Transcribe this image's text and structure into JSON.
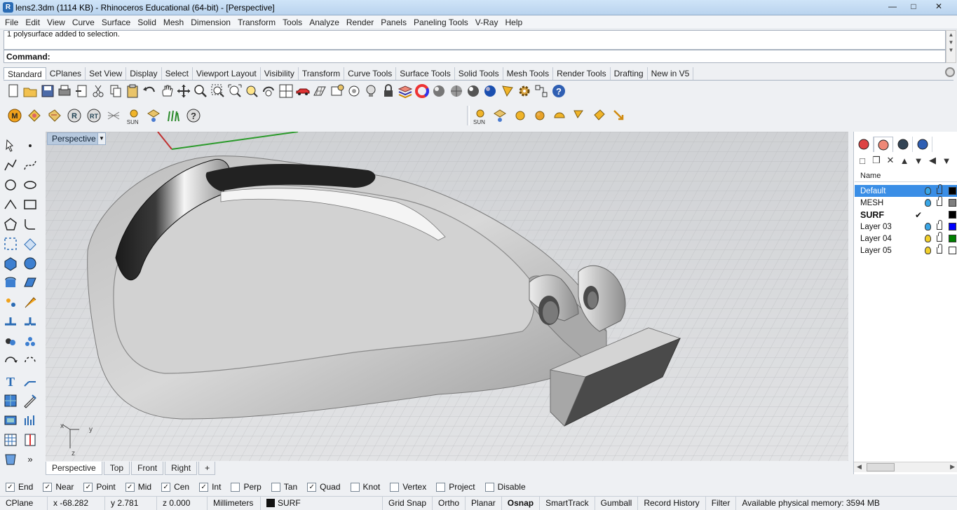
{
  "window": {
    "title": "lens2.3dm (1114 KB) - Rhinoceros Educational (64-bit) - [Perspective]",
    "app_icon": "rhino-logo-icon",
    "controls": [
      "minimize-icon",
      "maximize-icon",
      "close-icon"
    ]
  },
  "menu": [
    "File",
    "Edit",
    "View",
    "Curve",
    "Surface",
    "Solid",
    "Mesh",
    "Dimension",
    "Transform",
    "Tools",
    "Analyze",
    "Render",
    "Panels",
    "Paneling Tools",
    "V-Ray",
    "Help"
  ],
  "command": {
    "history": "1 polysurface added to selection.",
    "prompt": "Command:"
  },
  "toolbar_tabs": {
    "active": "Standard",
    "tabs": [
      "Standard",
      "CPlanes",
      "Set View",
      "Display",
      "Select",
      "Viewport Layout",
      "Visibility",
      "Transform",
      "Curve Tools",
      "Surface Tools",
      "Solid Tools",
      "Mesh Tools",
      "Render Tools",
      "Drafting",
      "New in V5"
    ]
  },
  "standard_toolbar": [
    "new-icon",
    "open-icon",
    "save-icon",
    "print-icon",
    "import-icon",
    "cut-icon",
    "copy-icon",
    "paste-icon",
    "undo-icon",
    "pan-hand-icon",
    "move-view-icon",
    "zoom-icon",
    "zoom-window-icon",
    "zoom-extents-icon",
    "zoom-selected-icon",
    "rotate-view-icon",
    "four-viewports-icon",
    "car-icon",
    "grid-toggle-icon",
    "cplane-icon",
    "lights-icon",
    "lightbulb-icon",
    "lock-icon",
    "layers-icon",
    "color-wheel-icon",
    "render-sphere-icon",
    "shaded-sphere-icon",
    "rendered-sphere-icon",
    "material-sphere-icon",
    "light-cone-icon",
    "options-gear-icon",
    "snap-icon",
    "help-icon"
  ],
  "vray_toolbar": {
    "icons": [
      "vray-m-icon",
      "vray-material-icon",
      "vray-tag-icon",
      "vray-r-icon",
      "vray-rt-icon",
      "vray-grid-icon",
      "vray-sun-icon",
      "vray-light-icon",
      "vray-fur-icon",
      "vray-help-icon"
    ],
    "sun_label": "SUN"
  },
  "lights_toolbar": {
    "icons": [
      "sun-light-icon",
      "plane-light-icon",
      "omni-light-icon",
      "sphere-light-icon",
      "dome-light-icon",
      "spot-light-icon",
      "ies-light-icon",
      "directional-light-icon"
    ],
    "sun_label": "SUN"
  },
  "left_toolbar": [
    "select-arrow-icon",
    "point-icon",
    "polyline-icon",
    "curve-cp-icon",
    "circle-icon",
    "ellipse-icon",
    "arc-icon",
    "rectangle-icon",
    "polygon-icon",
    "fillet-curve-icon",
    "surface-points-icon",
    "surface-edges-icon",
    "box-icon",
    "sphere-icon",
    "cylinder-icon",
    "surface-icon",
    "explode-icon",
    "trim-icon",
    "boolean-union-icon",
    "boolean-split-icon",
    "group-icon",
    "array-icon",
    "rotate-icon",
    "scale-icon",
    "text-icon",
    "dimension-icon",
    "mesh-icon",
    "analyze-icon",
    "block-icon",
    "bar-grid-icon",
    "panel-grid-icon",
    "panel-split-icon",
    "cup-icon",
    "more-icon"
  ],
  "viewport": {
    "title": "Perspective",
    "axis_x": "x",
    "axis_y": "y",
    "axis_z": "z"
  },
  "viewport_tabs": {
    "active": "Perspective",
    "tabs": [
      "Perspective",
      "Top",
      "Front",
      "Right"
    ],
    "add": "+"
  },
  "panel": {
    "tab_icons": [
      "properties-icon",
      "layers-icon",
      "display-icon",
      "help-icon"
    ],
    "tool_icons": [
      "new-layer-icon",
      "new-sublayer-icon",
      "delete-icon",
      "move-up-icon",
      "move-down-icon",
      "move-left-icon",
      "filter-icon"
    ],
    "header": "Name",
    "layers": [
      {
        "name": "Default",
        "selected": true,
        "current": false,
        "bulb": "#3aa6e6",
        "color": "#000000"
      },
      {
        "name": "MESH",
        "selected": false,
        "current": false,
        "bulb": "#3aa6e6",
        "color": "#7f7f7f"
      },
      {
        "name": "SURF",
        "selected": false,
        "current": true,
        "check": "✔",
        "bulb": "",
        "color": "#000000"
      },
      {
        "name": "Layer 03",
        "selected": false,
        "current": false,
        "bulb": "#3aa6e6",
        "color": "#0000ff"
      },
      {
        "name": "Layer 04",
        "selected": false,
        "current": false,
        "bulb": "#f2d02b",
        "color": "#007f00"
      },
      {
        "name": "Layer 05",
        "selected": false,
        "current": false,
        "bulb": "#f2d02b",
        "color": "#ffffff"
      }
    ]
  },
  "osnap": [
    {
      "label": "End",
      "checked": true
    },
    {
      "label": "Near",
      "checked": true
    },
    {
      "label": "Point",
      "checked": true
    },
    {
      "label": "Mid",
      "checked": true
    },
    {
      "label": "Cen",
      "checked": true
    },
    {
      "label": "Int",
      "checked": true
    },
    {
      "label": "Perp",
      "checked": false
    },
    {
      "label": "Tan",
      "checked": false
    },
    {
      "label": "Quad",
      "checked": true
    },
    {
      "label": "Knot",
      "checked": false
    },
    {
      "label": "Vertex",
      "checked": false
    },
    {
      "label": "Project",
      "checked": false
    },
    {
      "label": "Disable",
      "checked": false
    }
  ],
  "status": {
    "cplane": "CPlane",
    "x": "x -68.282",
    "y": "y 2.781",
    "z": "z 0.000",
    "units": "Millimeters",
    "layer": "SURF",
    "grid_snap": "Grid Snap",
    "ortho": "Ortho",
    "planar": "Planar",
    "osnap": "Osnap",
    "smarttrack": "SmartTrack",
    "gumball": "Gumball",
    "record_history": "Record History",
    "filter": "Filter",
    "memory": "Available physical memory: 3594 MB"
  }
}
